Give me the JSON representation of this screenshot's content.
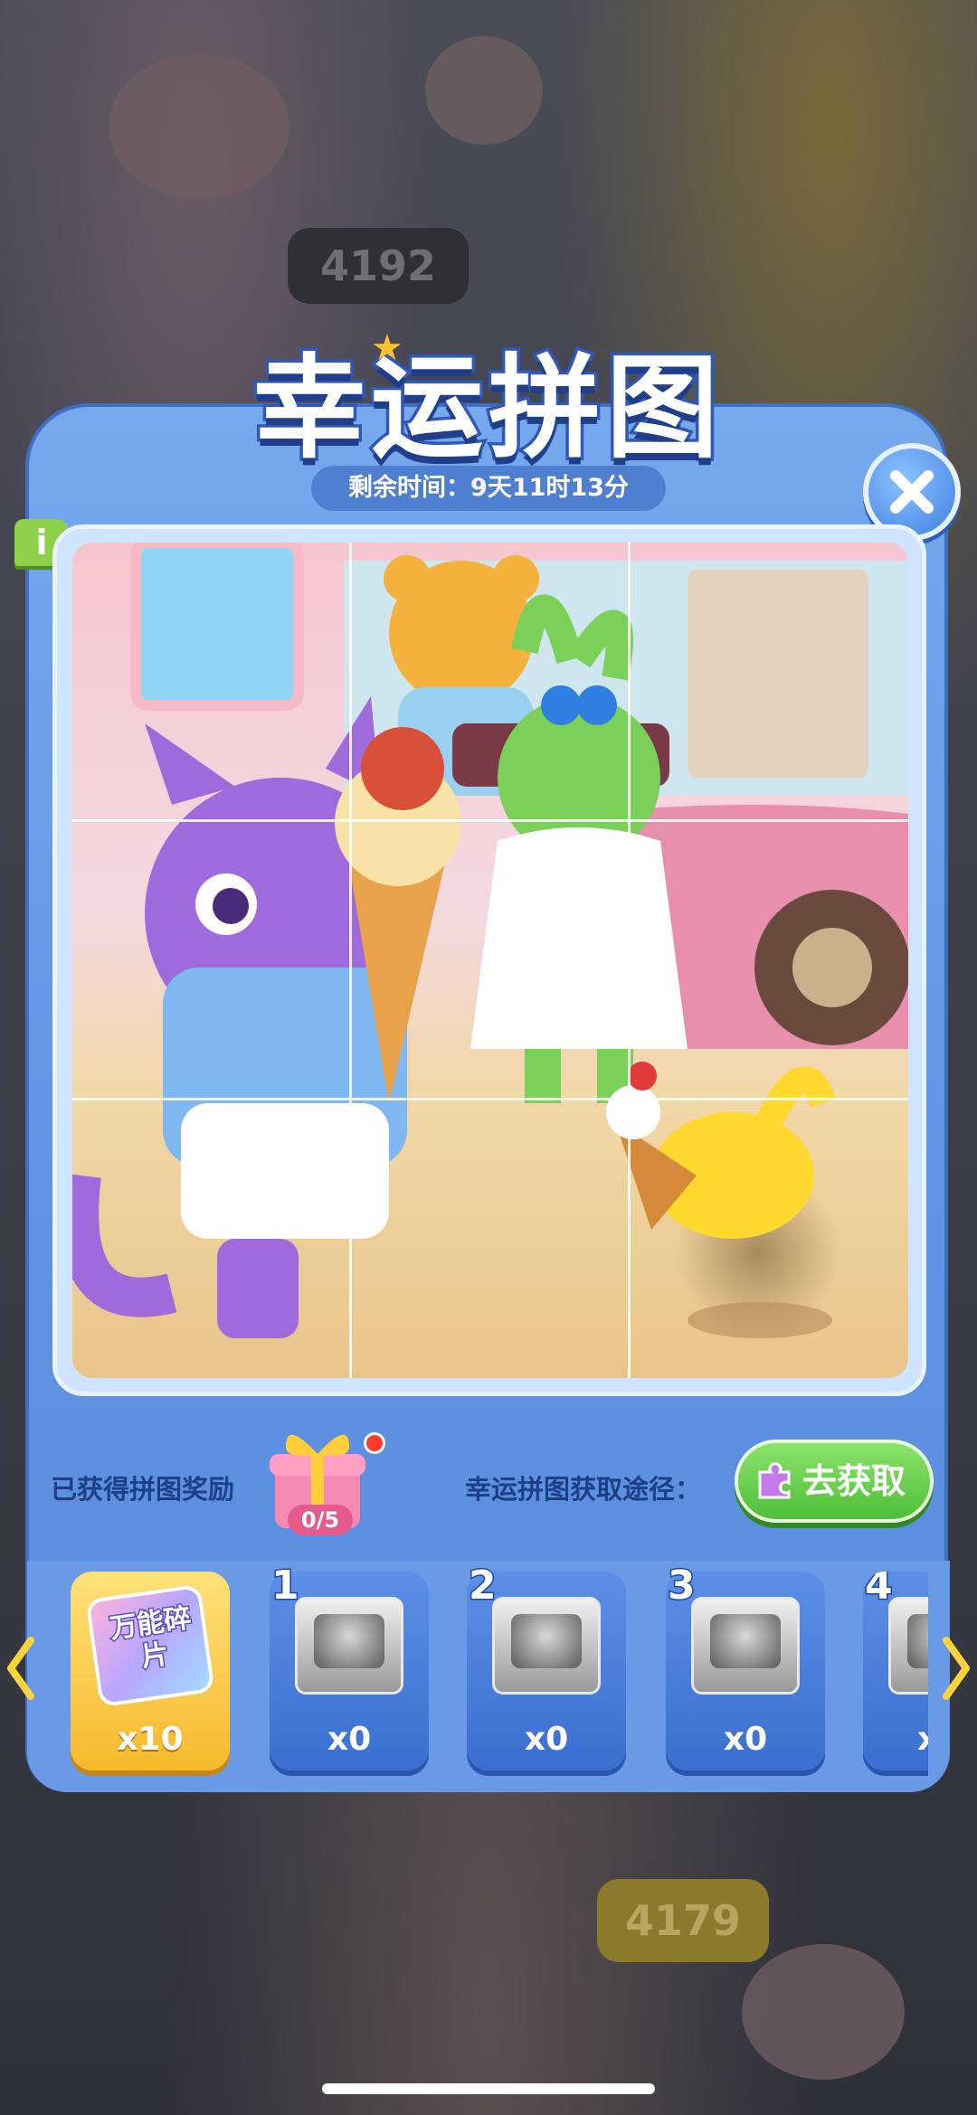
{
  "background": {
    "sign_top": "4192",
    "sign_bottom": "4179"
  },
  "event": {
    "title": "幸运拼图",
    "timer": "剩余时间：9天11时13分",
    "info_label": "i"
  },
  "rewards": {
    "label": "已获得拼图奖励",
    "progress": "0/5",
    "source_label": "幸运拼图获取途径：",
    "get_button": "去获取"
  },
  "pieces": [
    {
      "kind": "wild",
      "label": "万能碎片",
      "count": "x10"
    },
    {
      "kind": "piece",
      "number": "1",
      "count": "x0"
    },
    {
      "kind": "piece",
      "number": "2",
      "count": "x0"
    },
    {
      "kind": "piece",
      "number": "3",
      "count": "x0"
    },
    {
      "kind": "piece",
      "number": "4",
      "count": "x"
    }
  ],
  "colors": {
    "panel": "#6a9ae6",
    "accent_green": "#4fbf3a",
    "gold": "#f7b92c"
  }
}
